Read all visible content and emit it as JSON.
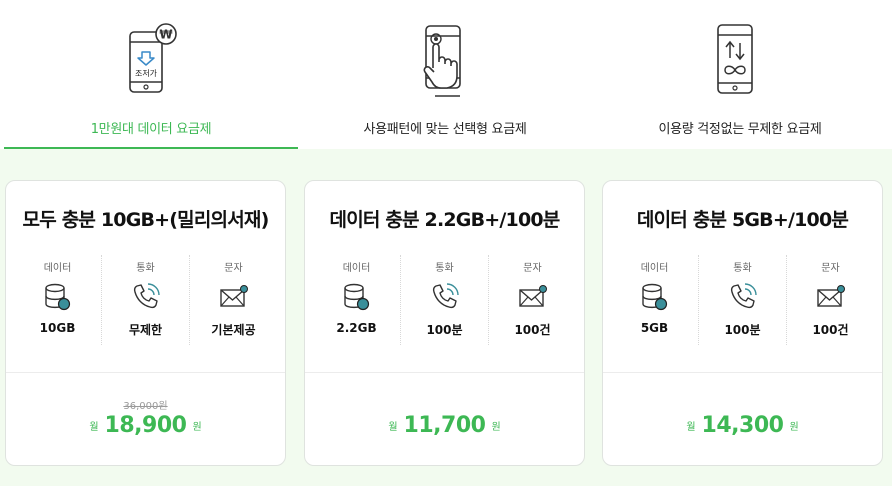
{
  "tabs": [
    {
      "label": "1만원대 데이터 요금제",
      "icon": "phone-won-save-icon",
      "icon_text": "조저가",
      "active": true
    },
    {
      "label": "사용패턴에 맞는 선택형 요금제",
      "icon": "phone-tap-icon",
      "active": false
    },
    {
      "label": "이용량 걱정없는 무제한 요금제",
      "icon": "phone-infinity-icon",
      "active": false
    }
  ],
  "feature_labels": {
    "data": "데이터",
    "call": "통화",
    "sms": "문자"
  },
  "plans": [
    {
      "title": "모두 충분 10GB+(밀리의서재)",
      "data": "10GB",
      "call": "무제한",
      "sms": "기본제공",
      "original_price": "36,000원",
      "price_prefix": "월",
      "price": "18,900",
      "price_suffix": "원"
    },
    {
      "title": "데이터 충분 2.2GB+/100분",
      "data": "2.2GB",
      "call": "100분",
      "sms": "100건",
      "original_price": "",
      "price_prefix": "월",
      "price": "11,700",
      "price_suffix": "원"
    },
    {
      "title": "데이터 충분 5GB+/100분",
      "data": "5GB",
      "call": "100분",
      "sms": "100건",
      "original_price": "",
      "price_prefix": "월",
      "price": "14,300",
      "price_suffix": "원"
    }
  ],
  "colors": {
    "accent": "#3db854",
    "icon_teal": "#3a8f9a",
    "background_tint": "#f2fbef"
  }
}
